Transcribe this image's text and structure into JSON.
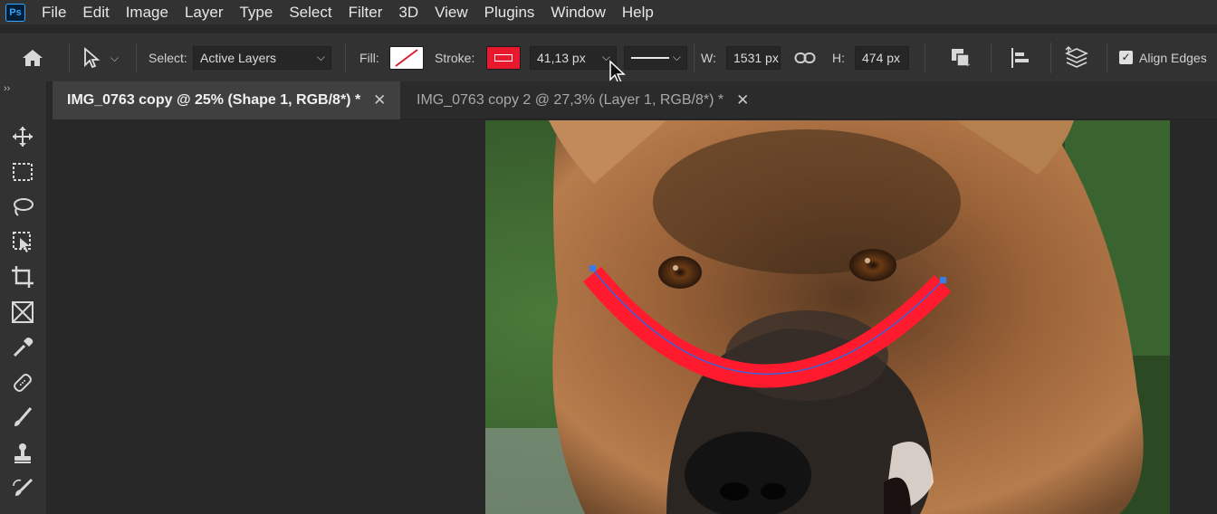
{
  "app": {
    "logo_text": "Ps"
  },
  "menu": [
    "File",
    "Edit",
    "Image",
    "Layer",
    "Type",
    "Select",
    "Filter",
    "3D",
    "View",
    "Plugins",
    "Window",
    "Help"
  ],
  "options": {
    "select_label": "Select:",
    "select_value": "Active Layers",
    "fill_label": "Fill:",
    "stroke_label": "Stroke:",
    "stroke_color": "#e8192c",
    "stroke_width": "41,13 px",
    "w_label": "W:",
    "w_value": "1531 px",
    "h_label": "H:",
    "h_value": "474 px",
    "align_edges_label": "Align Edges"
  },
  "tabs": [
    {
      "title": "IMG_0763 copy @ 25% (Shape 1, RGB/8*) *",
      "active": true
    },
    {
      "title": "IMG_0763 copy 2 @ 27,3% (Layer 1, RGB/8*) *",
      "active": false
    }
  ],
  "tools": [
    "move-icon",
    "marquee-icon",
    "lasso-icon",
    "object-select-icon",
    "crop-icon",
    "frame-icon",
    "eyedropper-icon",
    "healing-brush-icon",
    "brush-icon",
    "clone-stamp-icon",
    "history-brush-icon"
  ],
  "colors": {
    "accent": "#31a8ff",
    "shape_stroke": "#ff1a2e",
    "path": "#3b63d9"
  }
}
